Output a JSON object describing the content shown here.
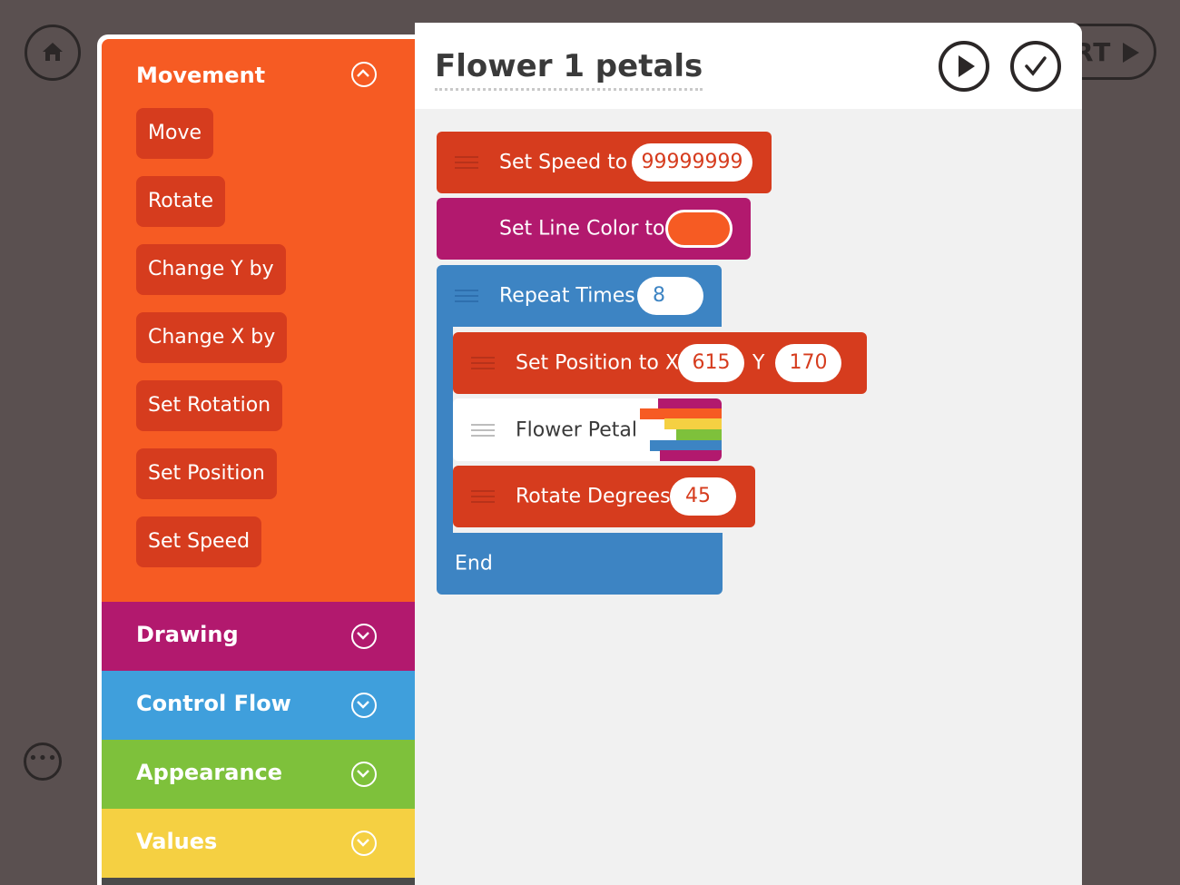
{
  "top_right": {
    "start_label": "RT"
  },
  "palette": {
    "movement": {
      "title": "Movement",
      "items": [
        "Move",
        "Rotate",
        "Change Y by",
        "Change X by",
        "Set Rotation",
        "Set Position",
        "Set Speed"
      ]
    },
    "drawing": {
      "title": "Drawing"
    },
    "control_flow": {
      "title": "Control Flow"
    },
    "appearance": {
      "title": "Appearance"
    },
    "values": {
      "title": "Values"
    }
  },
  "editor": {
    "title": "Flower 1 petals",
    "blocks": {
      "set_speed": {
        "label": "Set Speed to",
        "value": "99999999"
      },
      "set_line_color": {
        "label": "Set Line Color to",
        "swatch_color": "#f65b23"
      },
      "repeat": {
        "label": "Repeat Times",
        "value": "8"
      },
      "set_position": {
        "label": "Set Position to X",
        "x": "615",
        "y_label": "Y",
        "y": "170"
      },
      "flower_petal": {
        "label": "Flower Petal"
      },
      "rotate_degrees": {
        "label": "Rotate Degrees",
        "value": "45"
      },
      "end": {
        "label": "End"
      }
    }
  },
  "colors": {
    "movement": "#f65b23",
    "drawing": "#b2196e",
    "control_flow": "#3f9fdc",
    "appearance": "#7ec13b",
    "values": "#f5d042",
    "movement_block": "#d63c1e",
    "loop_block": "#3d84c3"
  }
}
